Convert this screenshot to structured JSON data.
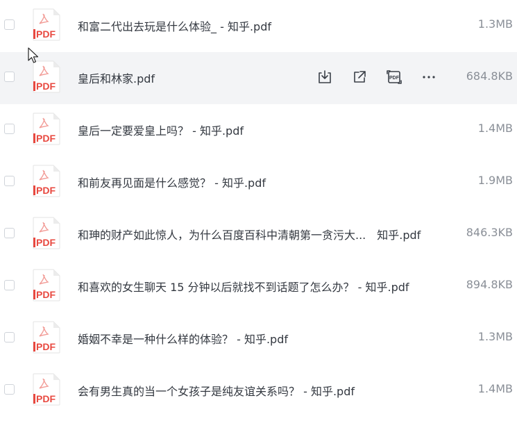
{
  "files": [
    {
      "name": "和富二代出去玩是什么体验_ - 知乎.pdf",
      "size": "1.3MB",
      "icon": "pdf-icon"
    },
    {
      "name": "皇后和林家.pdf",
      "size": "684.8KB",
      "icon": "pdf-icon",
      "hovered": true
    },
    {
      "name": "皇后一定要爱皇上吗？ - 知乎.pdf",
      "size": "1.4MB",
      "icon": "pdf-icon"
    },
    {
      "name": "和前友再见面是什么感觉？ - 知乎.pdf",
      "size": "1.9MB",
      "icon": "pdf-icon"
    },
    {
      "name": "和珅的财产如此惊人，为什么百度百科中清朝第一贪污大...　知乎.pdf",
      "size": "846.3KB",
      "icon": "pdf-icon"
    },
    {
      "name": "和喜欢的女生聊天 15 分钟以后就找不到话题了怎么办？ - 知乎.pdf",
      "size": "894.8KB",
      "icon": "pdf-icon"
    },
    {
      "name": "婚姻不幸是一种什么样的体验？ - 知乎.pdf",
      "size": "1.3MB",
      "icon": "pdf-icon"
    },
    {
      "name": "会有男生真的当一个女孩子是纯友谊关系吗？ - 知乎.pdf",
      "size": "1.4MB",
      "icon": "pdf-icon"
    }
  ],
  "icon_label": "PDF",
  "row_actions": [
    {
      "name": "download-icon"
    },
    {
      "name": "share-icon"
    },
    {
      "name": "pdf-convert-icon"
    },
    {
      "name": "more-icon"
    }
  ],
  "colors": {
    "pdf_red": "#e8483f",
    "hover_bg": "#f3f4f6",
    "text": "#333840",
    "size_text": "#8a8f97"
  }
}
